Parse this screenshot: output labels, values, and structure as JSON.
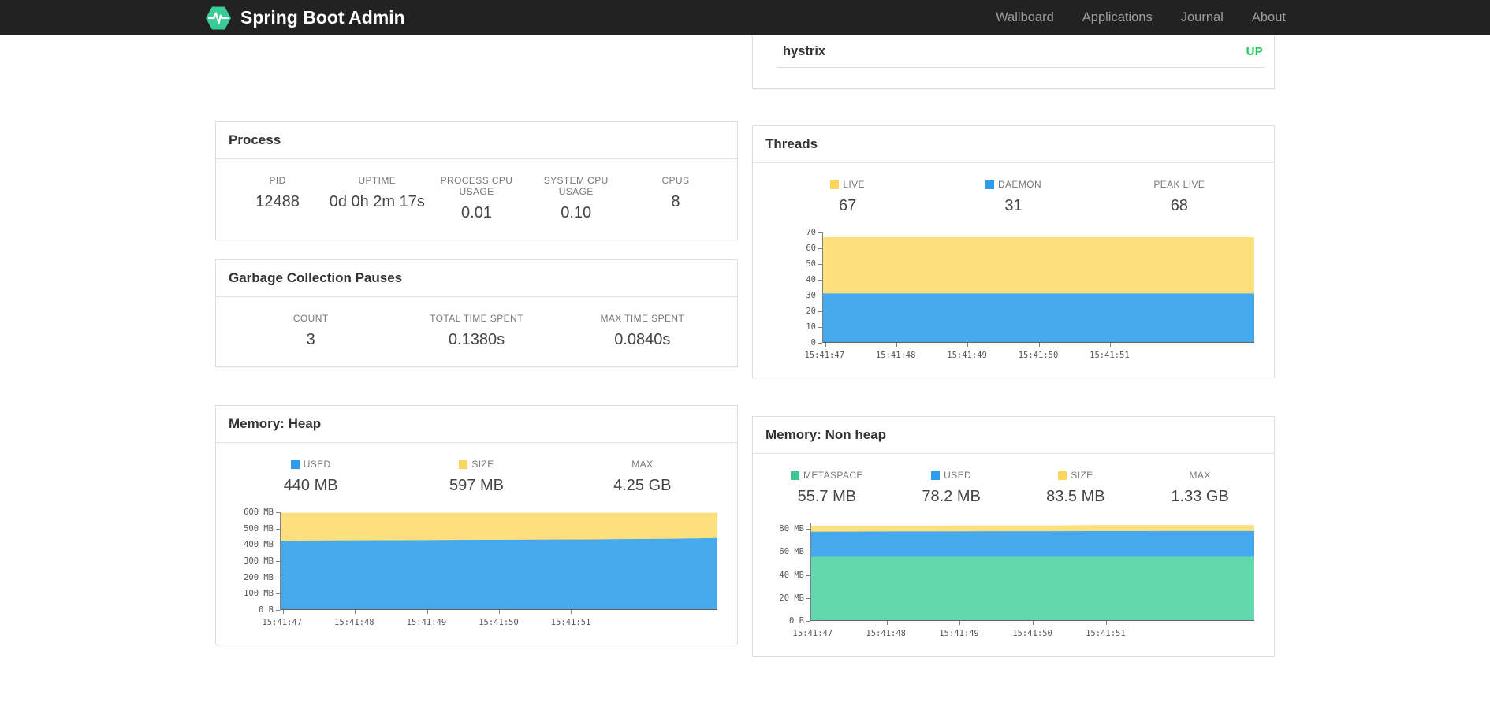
{
  "navbar": {
    "brand": "Spring Boot Admin",
    "items": [
      {
        "label": "Wallboard"
      },
      {
        "label": "Applications"
      },
      {
        "label": "Journal"
      },
      {
        "label": "About"
      }
    ]
  },
  "colors": {
    "navbar_bg": "#222222",
    "nav_link": "#9d9d9d",
    "logo_green": "#3bcb96",
    "status_up_green": "#1fc75c",
    "series_yellow": "#fbd45c",
    "series_yellow_fill": "#fde07e",
    "series_blue": "#2d9cea",
    "series_blue_fill": "#47a9ed",
    "series_green": "#3ec692",
    "series_green_fill": "#63d7ae"
  },
  "health_card": {
    "name": "hystrix",
    "status": "UP"
  },
  "cards": {
    "process": {
      "title": "Process",
      "metrics": [
        {
          "label": "PID",
          "value": "12488"
        },
        {
          "label": "UPTIME",
          "value": "0d 0h 2m 17s"
        },
        {
          "label": "PROCESS CPU USAGE",
          "value": "0.01"
        },
        {
          "label": "SYSTEM CPU USAGE",
          "value": "0.10"
        },
        {
          "label": "CPUS",
          "value": "8"
        }
      ]
    },
    "gc": {
      "title": "Garbage Collection Pauses",
      "metrics": [
        {
          "label": "COUNT",
          "value": "3"
        },
        {
          "label": "TOTAL TIME SPENT",
          "value": "0.1380s"
        },
        {
          "label": "MAX TIME SPENT",
          "value": "0.0840s"
        }
      ]
    },
    "threads": {
      "title": "Threads",
      "metrics": [
        {
          "label": "LIVE",
          "value": "67",
          "swatch": "#fbd45c"
        },
        {
          "label": "DAEMON",
          "value": "31",
          "swatch": "#2d9cea"
        },
        {
          "label": "PEAK LIVE",
          "value": "68"
        }
      ]
    },
    "heap": {
      "title": "Memory: Heap",
      "metrics": [
        {
          "label": "USED",
          "value": "440 MB",
          "swatch": "#2d9cea"
        },
        {
          "label": "SIZE",
          "value": "597 MB",
          "swatch": "#fbd45c"
        },
        {
          "label": "MAX",
          "value": "4.25 GB"
        }
      ]
    },
    "nonheap": {
      "title": "Memory: Non heap",
      "metrics": [
        {
          "label": "METASPACE",
          "value": "55.7 MB",
          "swatch": "#3ec692"
        },
        {
          "label": "USED",
          "value": "78.2 MB",
          "swatch": "#2d9cea"
        },
        {
          "label": "SIZE",
          "value": "83.5 MB",
          "swatch": "#fbd45c"
        },
        {
          "label": "MAX",
          "value": "1.33 GB"
        }
      ]
    }
  },
  "chart_data": [
    {
      "id": "threads",
      "type": "area",
      "title": "Threads",
      "mode": "overlay",
      "grid": false,
      "legend_position": "top",
      "xlabel": "",
      "ylabel": "",
      "ylim": [
        0,
        70
      ],
      "yticks": [
        {
          "value": 0,
          "label": "0"
        },
        {
          "value": 10,
          "label": "10"
        },
        {
          "value": 20,
          "label": "20"
        },
        {
          "value": 30,
          "label": "30"
        },
        {
          "value": 40,
          "label": "40"
        },
        {
          "value": 50,
          "label": "50"
        },
        {
          "value": 60,
          "label": "60"
        },
        {
          "value": 70,
          "label": "70"
        }
      ],
      "x_labels": [
        "15:41:47",
        "15:41:48",
        "15:41:49",
        "15:41:50",
        "15:41:51"
      ],
      "x_label_fractions": [
        0.005,
        0.17,
        0.335,
        0.5,
        0.665
      ],
      "series": [
        {
          "name": "LIVE",
          "color": "#fde07e",
          "values": [
            67,
            67,
            67,
            67,
            67,
            67,
            67,
            67,
            67,
            67,
            67,
            67
          ]
        },
        {
          "name": "DAEMON",
          "color": "#47a9ed",
          "values": [
            31,
            31,
            31,
            31,
            31,
            31,
            31,
            31,
            31,
            31,
            31,
            31
          ]
        }
      ]
    },
    {
      "id": "memory-heap",
      "type": "area",
      "title": "Memory: Heap",
      "mode": "overlay",
      "grid": false,
      "legend_position": "top",
      "xlabel": "",
      "ylabel": "",
      "ylim": [
        0,
        600
      ],
      "yticks": [
        {
          "value": 0,
          "label": "0 B"
        },
        {
          "value": 100,
          "label": "100 MB"
        },
        {
          "value": 200,
          "label": "200 MB"
        },
        {
          "value": 300,
          "label": "300 MB"
        },
        {
          "value": 400,
          "label": "400 MB"
        },
        {
          "value": 500,
          "label": "500 MB"
        },
        {
          "value": 600,
          "label": "600 MB"
        }
      ],
      "x_labels": [
        "15:41:47",
        "15:41:48",
        "15:41:49",
        "15:41:50",
        "15:41:51"
      ],
      "x_label_fractions": [
        0.005,
        0.17,
        0.335,
        0.5,
        0.665
      ],
      "series": [
        {
          "name": "SIZE",
          "color": "#fde07e",
          "values": [
            597,
            597,
            597,
            597,
            597,
            597,
            597,
            597,
            597,
            597,
            597,
            597
          ]
        },
        {
          "name": "USED",
          "color": "#47a9ed",
          "values": [
            424,
            425,
            426,
            427,
            428,
            429,
            430,
            431,
            432,
            434,
            436,
            440
          ]
        }
      ]
    },
    {
      "id": "memory-nonheap",
      "type": "area",
      "title": "Memory: Non heap",
      "mode": "overlay",
      "grid": false,
      "legend_position": "top",
      "xlabel": "",
      "ylabel": "",
      "ylim": [
        0,
        85
      ],
      "yticks": [
        {
          "value": 0,
          "label": "0 B"
        },
        {
          "value": 20,
          "label": "20 MB"
        },
        {
          "value": 40,
          "label": "40 MB"
        },
        {
          "value": 60,
          "label": "60 MB"
        },
        {
          "value": 80,
          "label": "80 MB"
        }
      ],
      "x_labels": [
        "15:41:47",
        "15:41:48",
        "15:41:49",
        "15:41:50",
        "15:41:51"
      ],
      "x_label_fractions": [
        0.005,
        0.17,
        0.335,
        0.5,
        0.665
      ],
      "series": [
        {
          "name": "SIZE",
          "color": "#fde07e",
          "values": [
            82.8,
            82.8,
            82.8,
            82.8,
            83.1,
            83.1,
            83.1,
            83.5,
            83.5,
            83.5,
            83.5,
            83.5
          ]
        },
        {
          "name": "USED",
          "color": "#47a9ed",
          "values": [
            77.6,
            77.7,
            77.8,
            77.8,
            77.9,
            78,
            78,
            78.1,
            78.1,
            78.2,
            78.2,
            78.2
          ]
        },
        {
          "name": "METASPACE",
          "color": "#63d7ae",
          "values": [
            55.7,
            55.7,
            55.7,
            55.7,
            55.7,
            55.7,
            55.7,
            55.7,
            55.7,
            55.7,
            55.7,
            55.7
          ]
        }
      ]
    }
  ]
}
